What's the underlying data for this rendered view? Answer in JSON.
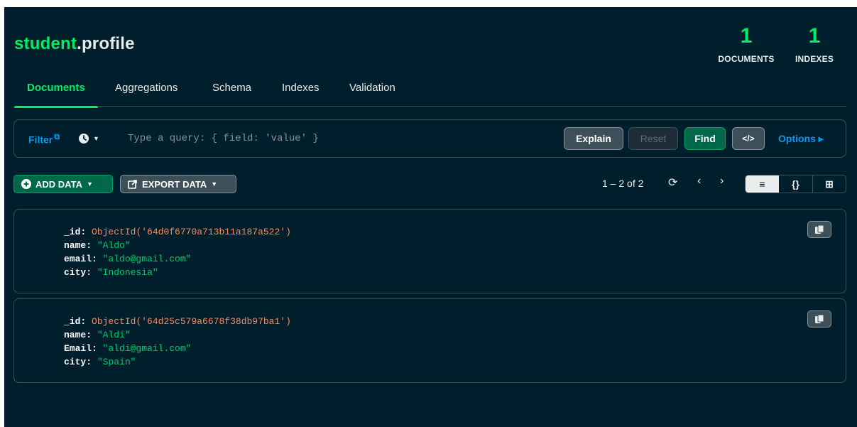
{
  "collection": {
    "db": "student",
    "separator": ".",
    "name": "profile"
  },
  "stats": {
    "documents": {
      "count": "1",
      "label": "DOCUMENTS"
    },
    "indexes": {
      "count": "1",
      "label": "INDEXES"
    }
  },
  "tabs": [
    {
      "label": "Documents",
      "active": true
    },
    {
      "label": "Aggregations",
      "active": false
    },
    {
      "label": "Schema",
      "active": false
    },
    {
      "label": "Indexes",
      "active": false
    },
    {
      "label": "Validation",
      "active": false
    }
  ],
  "query": {
    "filter_label": "Filter",
    "placeholder": "Type a query: { field: 'value' }",
    "explain_label": "Explain",
    "reset_label": "Reset",
    "find_label": "Find",
    "code_label": "</>",
    "options_label": "Options ▸"
  },
  "toolbar": {
    "add_data_label": "ADD DATA",
    "export_data_label": "EXPORT DATA",
    "pagination": "1 – 2 of 2"
  },
  "documents": [
    {
      "fields": [
        {
          "key": "_id:",
          "value": "ObjectId('64d0f6770a713b11a187a522')",
          "type": "oid"
        },
        {
          "key": "name:",
          "value": "\"Aldo\"",
          "type": "str"
        },
        {
          "key": "email:",
          "value": "\"aldo@gmail.com\"",
          "type": "str"
        },
        {
          "key": "city:",
          "value": "\"Indonesia\"",
          "type": "str"
        }
      ]
    },
    {
      "fields": [
        {
          "key": "_id:",
          "value": "ObjectId('64d25c579a6678f38db97ba1')",
          "type": "oid"
        },
        {
          "key": "name:",
          "value": "\"Aldi\"",
          "type": "str"
        },
        {
          "key": "Email:",
          "value": "\"aldi@gmail.com\"",
          "type": "str"
        },
        {
          "key": "city:",
          "value": "\"Spain\"",
          "type": "str"
        }
      ]
    }
  ],
  "colors": {
    "background": "#001e2b",
    "accent_green": "#00ed64",
    "link_blue": "#0498ec",
    "objectid": "#fa8b5e",
    "string": "#00c969"
  }
}
